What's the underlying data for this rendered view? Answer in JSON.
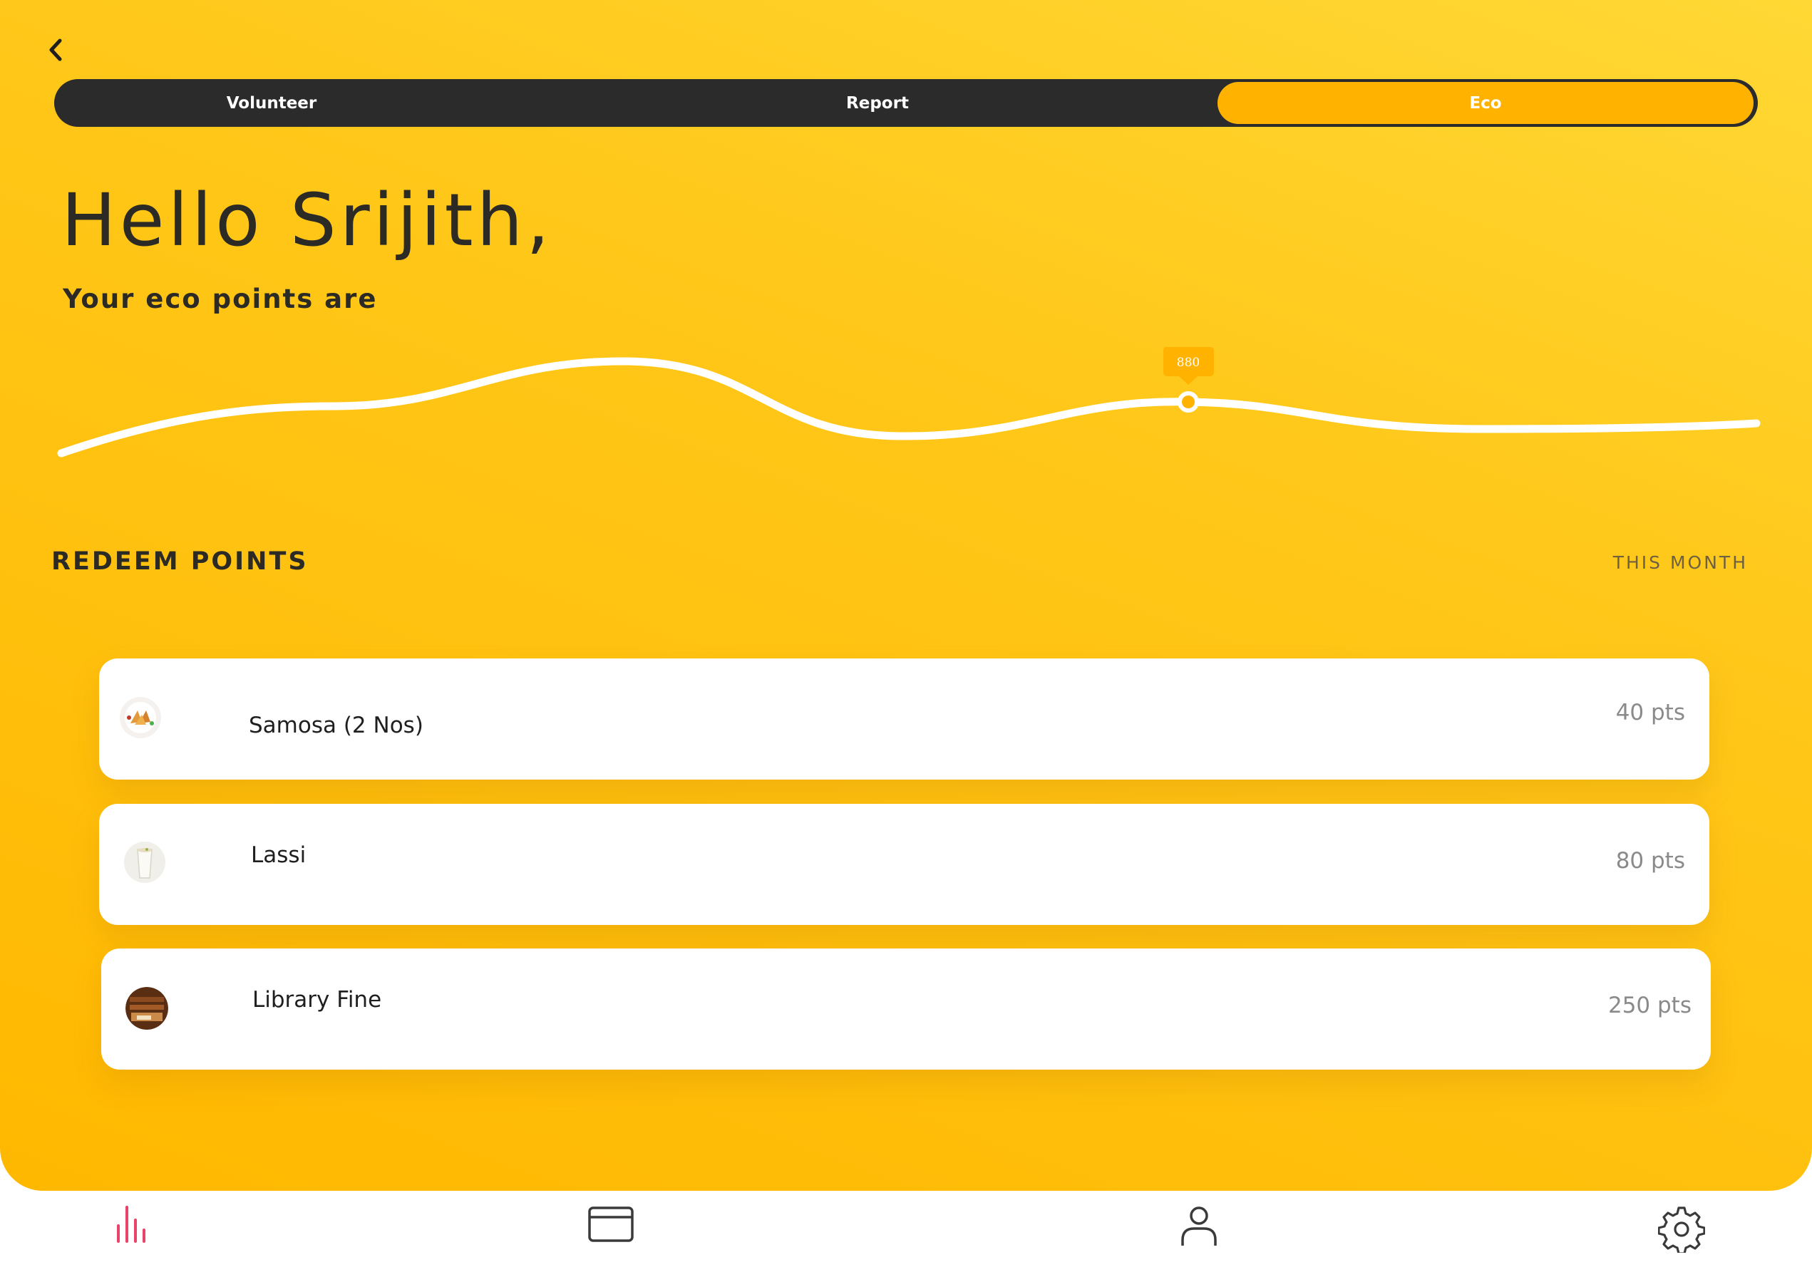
{
  "tabs": [
    {
      "label": "Volunteer",
      "active": false
    },
    {
      "label": "Report",
      "active": false
    },
    {
      "label": "Eco",
      "active": true
    }
  ],
  "greeting": "Hello Srijith,",
  "subtitle": "Your eco points are",
  "points_marker": "880",
  "redeem": {
    "title": "REDEEM POINTS",
    "period": "THIS MONTH",
    "items": [
      {
        "name": "Samosa (2 Nos)",
        "points": "40 pts",
        "icon": "samosa-thumbnail"
      },
      {
        "name": "Lassi",
        "points": "80 pts",
        "icon": "lassi-thumbnail"
      },
      {
        "name": "Library Fine",
        "points": "250 pts",
        "icon": "library-thumbnail"
      }
    ]
  },
  "bottom_nav": [
    "stats-icon",
    "card-icon",
    "profile-icon",
    "settings-icon"
  ],
  "colors": {
    "accent": "#ffb300",
    "tab_bar": "#2b2b2b",
    "nav_active": "#e8436a",
    "nav_inactive": "#3a3a3a"
  }
}
